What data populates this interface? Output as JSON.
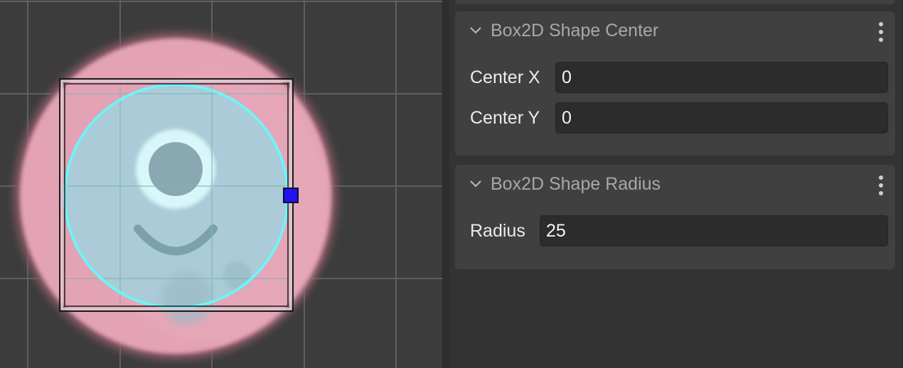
{
  "viewport": {
    "grid_color": "#5f5f5f",
    "background_color": "#3c3c3c",
    "sprite_color": "#e4a3b4",
    "shape_outline_color": "#6ff3f8",
    "selection_box_color": "#d9c9d3",
    "handle_color": "#1f12f0",
    "handle_icon": "resize-handle-icon"
  },
  "inspector": {
    "shape_center": {
      "title": "Box2D Shape Center",
      "collapse_icon": "chevron-down-icon",
      "menu_icon": "kebab-menu-icon",
      "center_x_label": "Center X",
      "center_x_value": "0",
      "center_y_label": "Center Y",
      "center_y_value": "0"
    },
    "shape_radius": {
      "title": "Box2D Shape Radius",
      "collapse_icon": "chevron-down-icon",
      "menu_icon": "kebab-menu-icon",
      "radius_label": "Radius",
      "radius_value": "25"
    }
  }
}
